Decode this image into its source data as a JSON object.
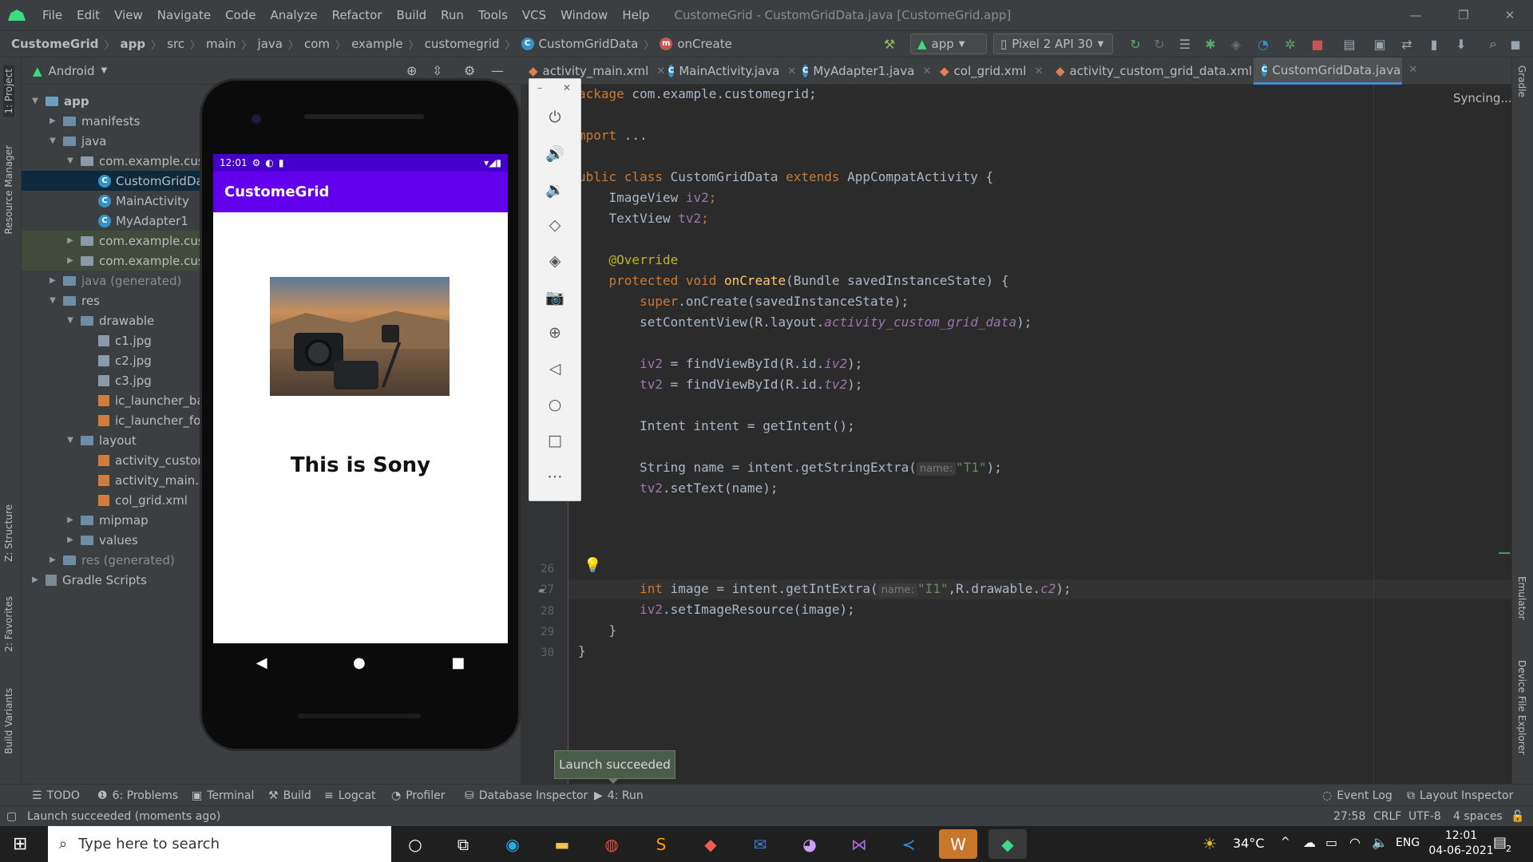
{
  "menubar": {
    "items": [
      "File",
      "Edit",
      "View",
      "Navigate",
      "Code",
      "Analyze",
      "Refactor",
      "Build",
      "Run",
      "Tools",
      "VCS",
      "Window",
      "Help"
    ],
    "title": "CustomeGrid - CustomGridData.java [CustomeGrid.app]"
  },
  "navbar": {
    "breadcrumbs": [
      "CustomeGrid",
      "app",
      "src",
      "main",
      "java",
      "com",
      "example",
      "customegrid",
      "CustomGridData",
      "onCreate"
    ],
    "run_config": "app",
    "device": "Pixel 2 API 30"
  },
  "project": {
    "view": "Android",
    "tree": [
      {
        "label": "app",
        "indent": 0,
        "kind": "module",
        "open": true
      },
      {
        "label": "manifests",
        "indent": 1,
        "kind": "folder",
        "open": false
      },
      {
        "label": "java",
        "indent": 1,
        "kind": "folder",
        "open": true
      },
      {
        "label": "com.example.custo",
        "indent": 2,
        "kind": "pkg",
        "open": true
      },
      {
        "label": "CustomGridDat",
        "indent": 3,
        "kind": "class",
        "selected": true
      },
      {
        "label": "MainActivity",
        "indent": 3,
        "kind": "class"
      },
      {
        "label": "MyAdapter1",
        "indent": 3,
        "kind": "class"
      },
      {
        "label": "com.example.custo",
        "indent": 2,
        "kind": "pkg",
        "open": false,
        "hl": true
      },
      {
        "label": "com.example.custo",
        "indent": 2,
        "kind": "pkg",
        "open": false,
        "hl": true
      },
      {
        "label": "java (generated)",
        "indent": 1,
        "kind": "folder",
        "open": false,
        "dim": true
      },
      {
        "label": "res",
        "indent": 1,
        "kind": "folder",
        "open": true
      },
      {
        "label": "drawable",
        "indent": 2,
        "kind": "folder",
        "open": true
      },
      {
        "label": "c1.jpg",
        "indent": 3,
        "kind": "file"
      },
      {
        "label": "c2.jpg",
        "indent": 3,
        "kind": "file"
      },
      {
        "label": "c3.jpg",
        "indent": 3,
        "kind": "file"
      },
      {
        "label": "ic_launcher_bac",
        "indent": 3,
        "kind": "xml"
      },
      {
        "label": "ic_launcher_fore",
        "indent": 3,
        "kind": "xml"
      },
      {
        "label": "layout",
        "indent": 2,
        "kind": "folder",
        "open": true
      },
      {
        "label": "activity_custom",
        "indent": 3,
        "kind": "xml"
      },
      {
        "label": "activity_main.xr",
        "indent": 3,
        "kind": "xml"
      },
      {
        "label": "col_grid.xml",
        "indent": 3,
        "kind": "xml"
      },
      {
        "label": "mipmap",
        "indent": 2,
        "kind": "folder",
        "open": false
      },
      {
        "label": "values",
        "indent": 2,
        "kind": "folder",
        "open": false
      },
      {
        "label": "res (generated)",
        "indent": 1,
        "kind": "folder",
        "open": false,
        "dim": true
      },
      {
        "label": "Gradle Scripts",
        "indent": 0,
        "kind": "gradle",
        "open": false
      }
    ]
  },
  "left_tabs": [
    "1: Project",
    "Resource Manager",
    "Z: Structure",
    "2: Favorites",
    "Build Variants"
  ],
  "right_tabs": [
    "Gradle",
    "Emulator",
    "Device File Explorer"
  ],
  "tabs": [
    "activity_main.xml",
    "MainActivity.java",
    "MyAdapter1.java",
    "col_grid.xml",
    "activity_custom_grid_data.xml",
    "CustomGridData.java"
  ],
  "active_tab": "CustomGridData.java",
  "syncing": "Syncing...",
  "gutter_lines": [
    "26",
    "27",
    "28",
    "29",
    "30"
  ],
  "code": {
    "l1_kw": "ackage",
    "l1_rest": " com.example.customegrid;",
    "l2_kw": "mport",
    "l2_rest": " ...",
    "l3_kw1": "ublic class",
    "l3_name": " CustomGridData ",
    "l3_kw2": "extends",
    "l3_rest": " AppCompatActivity {",
    "l4": "    ImageView ",
    "l4_f": "iv2",
    "l4_e": ";",
    "l5": "    TextView ",
    "l5_f": "tv2",
    "l5_e": ";",
    "l6": "    @Override",
    "l7_kw": "    protected void ",
    "l7_fn": "onCreate",
    "l7_rest": "(Bundle savedInstanceState) {",
    "l8_kw": "        super",
    "l8_rest": ".onCreate(savedInstanceState);",
    "l9_a": "        setContentView(R.layout.",
    "l9_it": "activity_custom_grid_data",
    "l9_b": ");",
    "l10_a": "        ",
    "l10_f": "iv2",
    "l10_b": " = findViewById(R.id.",
    "l10_it": "iv2",
    "l10_c": ");",
    "l11_a": "        ",
    "l11_f": "tv2",
    "l11_b": " = findViewById(R.id.",
    "l11_it": "tv2",
    "l11_c": ");",
    "l12": "        Intent intent = getIntent();",
    "l13_a": "        String name = intent.getStringExtra(",
    "l13_hint": "name:",
    "l13_str": "\"T1\"",
    "l13_b": ");",
    "l14_a": "        ",
    "l14_f": "tv2",
    "l14_b": ".setText(name);",
    "l15_kw": "        int",
    "l15_a": " image = intent.getIntExtra(",
    "l15_hint": "name:",
    "l15_str": "\"I1\"",
    "l15_b": ",R.drawable.",
    "l15_it": "c2",
    "l15_c": ");",
    "l16_a": "        ",
    "l16_f": "iv2",
    "l16_b": ".setImageResource(image);",
    "l17": "    }",
    "l18": "}"
  },
  "emulator": {
    "status_time": "12:01",
    "app_title": "CustomeGrid",
    "text": "This is Sony"
  },
  "tooltip": "Launch succeeded",
  "bottom_tools": [
    "TODO",
    "6: Problems",
    "Terminal",
    "Build",
    "Logcat",
    "Profiler",
    "Database Inspector",
    "4: Run"
  ],
  "bottom_right": [
    "Event Log",
    "Layout Inspector"
  ],
  "status": {
    "message": "Launch succeeded (moments ago)",
    "position": "27:58",
    "line_sep": "CRLF",
    "encoding": "UTF-8",
    "indent": "4 spaces"
  },
  "taskbar": {
    "search_placeholder": "Type here to search",
    "weather": "34°C",
    "lang": "ENG",
    "time": "12:01",
    "date": "04-06-2021",
    "notif_count": "2"
  }
}
